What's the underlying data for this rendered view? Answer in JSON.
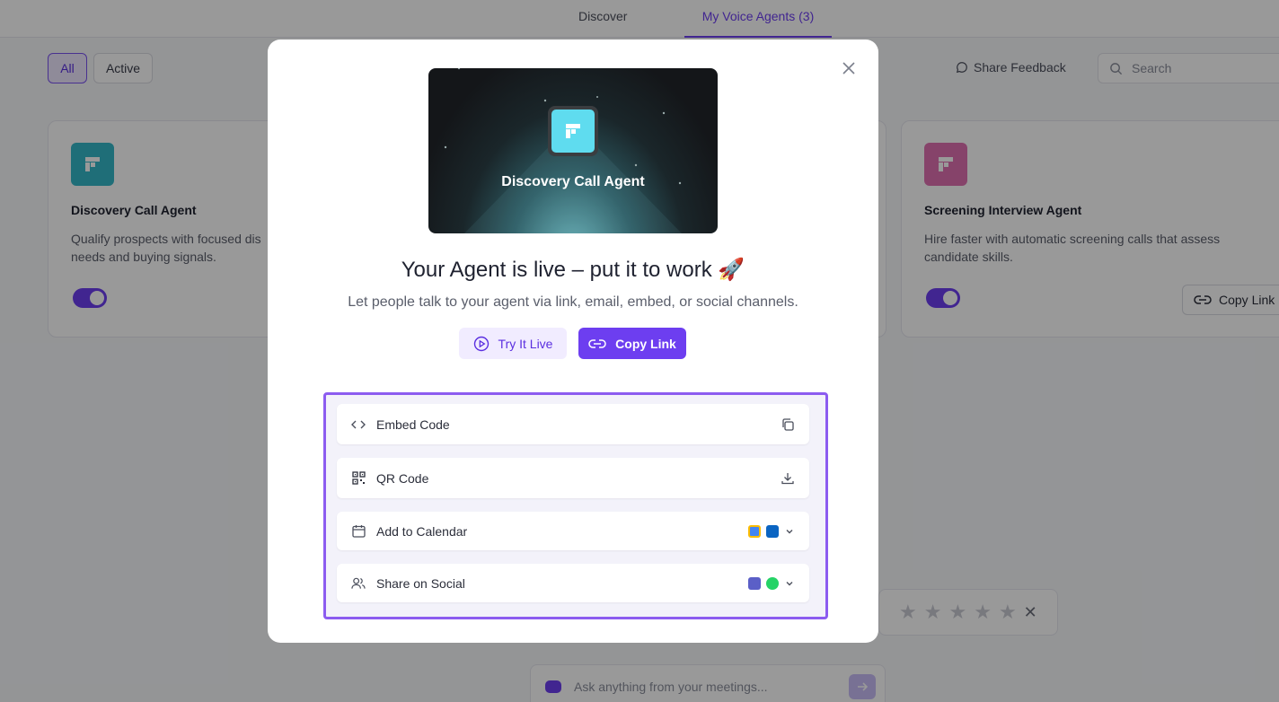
{
  "topnav": {
    "tab_discover": "Discover",
    "tab_my_agents": "My Voice Agents (3)"
  },
  "filters": {
    "all": "All",
    "active": "Active"
  },
  "toolbar": {
    "share_feedback": "Share Feedback",
    "search_placeholder": "Search"
  },
  "cards": [
    {
      "title": "Discovery Call Agent",
      "desc": "Qualify prospects with focused discovery — needs and buying signals.",
      "desc_visible_line1": "Qualify prospects with focused dis",
      "desc_visible_line2": "needs and buying signals.",
      "logo_color": "#35b8c9"
    },
    {
      "title": "Screening Interview Agent",
      "desc_line1": "Hire faster with automatic screening calls that assess",
      "desc_line2": "candidate skills.",
      "copy_link": "Copy Link",
      "logo_color": "#e071b1"
    }
  ],
  "ask": {
    "placeholder": "Ask anything from your meetings..."
  },
  "modal": {
    "hero_title": "Discovery Call Agent",
    "headline": "Your Agent is live – put it to work 🚀",
    "subtitle": "Let people talk to your agent via link, email, embed, or social channels.",
    "try_live": "Try It Live",
    "copy_link": "Copy Link",
    "options": [
      {
        "label": "Embed Code",
        "icon": "code-icon",
        "action_icon": "copy-icon"
      },
      {
        "label": "QR Code",
        "icon": "qr-icon",
        "action_icon": "download-icon"
      },
      {
        "label": "Add to Calendar",
        "icon": "calendar-icon",
        "action_icon": "chevron-down-icon"
      },
      {
        "label": "Share on Social",
        "icon": "users-icon",
        "action_icon": "chevron-down-icon"
      }
    ]
  },
  "colors": {
    "accent": "#6d3ef0",
    "accent_light": "#f1ecff",
    "highlight_border": "#8c5cf0"
  }
}
